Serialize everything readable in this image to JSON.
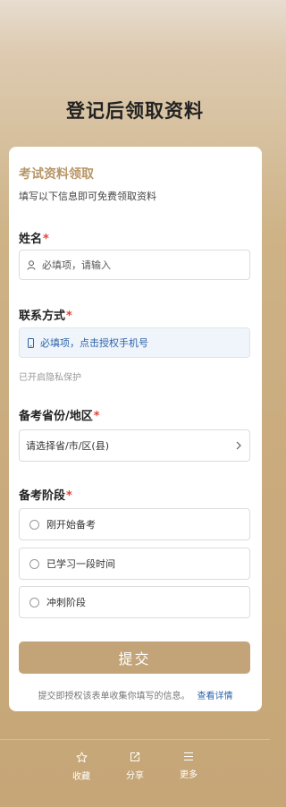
{
  "page": {
    "title": "登记后领取资料"
  },
  "form": {
    "title": "考试资料领取",
    "subtitle": "填写以下信息即可免费领取资料",
    "required_mark": "*",
    "name": {
      "label": "姓名",
      "placeholder": "必填项，请输入"
    },
    "phone": {
      "label": "联系方式",
      "placeholder": "必填项，点击授权手机号",
      "hint": "已开启隐私保护"
    },
    "region": {
      "label": "备考省份/地区",
      "placeholder": "请选择省/市/区(县)"
    },
    "stage": {
      "label": "备考阶段",
      "options": [
        "刚开始备考",
        "已学习一段时间",
        "冲刺阶段"
      ]
    },
    "submit_label": "提交",
    "agreement_text": "提交即授权该表单收集你填写的信息。",
    "agreement_link": "查看详情"
  },
  "bottom_nav": [
    {
      "label": "收藏",
      "icon": "star-icon"
    },
    {
      "label": "分享",
      "icon": "share-icon"
    },
    {
      "label": "更多",
      "icon": "menu-icon"
    }
  ],
  "colors": {
    "accent": "#b89668",
    "button": "#c2a478",
    "link": "#2b63a8",
    "required": "#e0453a"
  }
}
